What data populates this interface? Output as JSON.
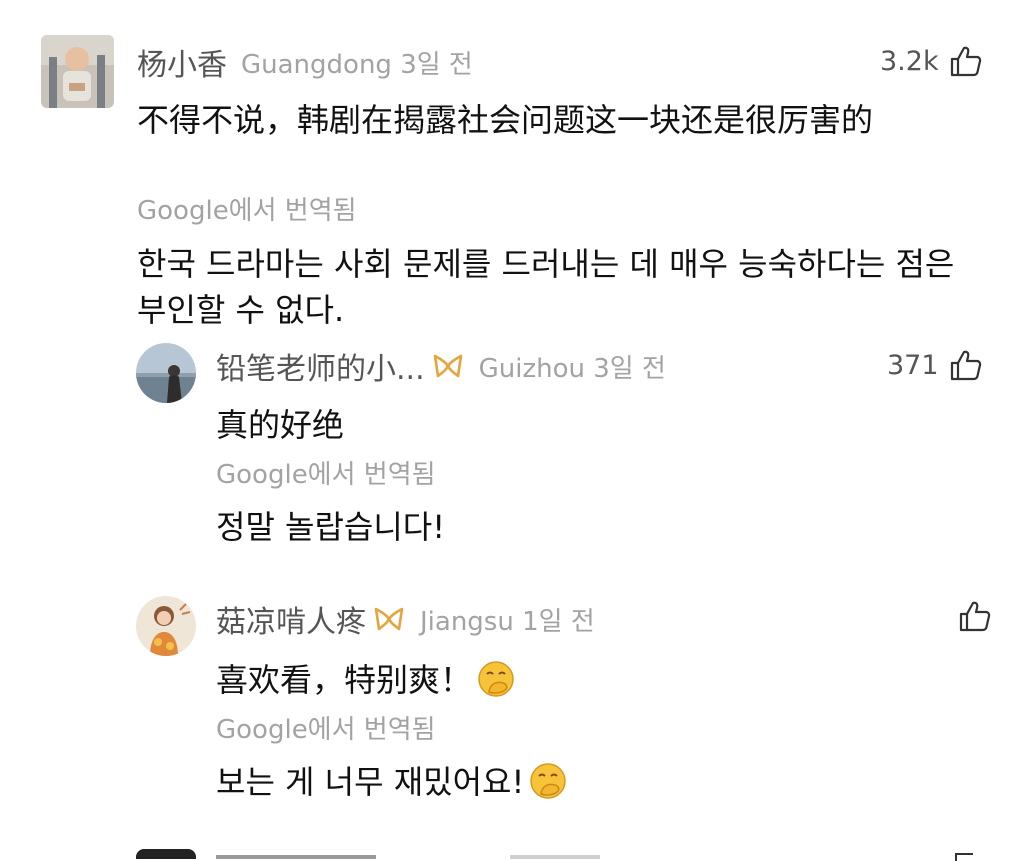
{
  "comments": [
    {
      "username": "杨小香",
      "region_time": "Guangdong 3일 전",
      "likes": "3.2k",
      "text": "不得不说，韩剧在揭露社会问题这一块还是很厉害的",
      "translated_label": "Google에서 번역됨",
      "translation_line1": "한국 드라마는 사회 문제를 드러내는 데 매우 능숙하다는 점은",
      "translation_line2": "부인할 수 없다."
    },
    {
      "username": "铅笔老师的小...",
      "region_time": "Guizhou 3일 전",
      "likes": "371",
      "text": "真的好绝",
      "translated_label": "Google에서 번역됨",
      "translation": "정말 놀랍습니다!"
    },
    {
      "username": "菇凉啃人疼",
      "region_time": "Jiangsu 1일 전",
      "likes": "",
      "text": "喜欢看，特别爽！",
      "translated_label": "Google에서 번역됨",
      "translation": "보는 게 너무 재밌어요!"
    }
  ],
  "icons": {
    "like": "thumbs-up-outline-icon",
    "badge": "gold-ribbon-badge-icon",
    "emoji": "hand-over-mouth-emoji-icon"
  },
  "colors": {
    "text_primary": "#111111",
    "text_secondary": "#555555",
    "text_muted": "#a3a3a3",
    "badge_gold": "#e8a43c",
    "emoji_yellow": "#f6c33a"
  }
}
